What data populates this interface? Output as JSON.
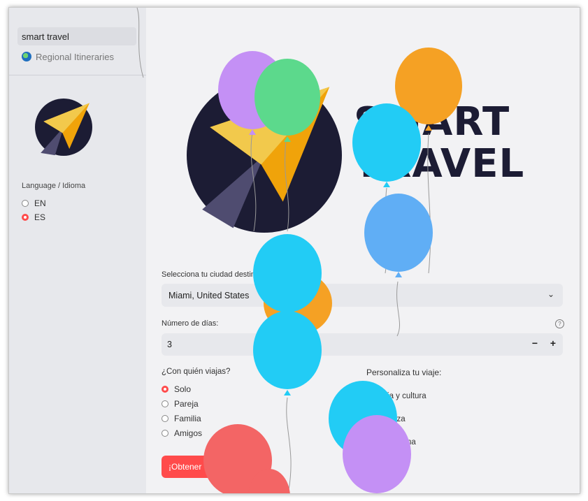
{
  "sidebar": {
    "items": [
      {
        "label": "smart travel",
        "active": true
      },
      {
        "label": "Regional Itineraries",
        "icon": "globe-icon"
      }
    ],
    "language": {
      "label": "Language / Idioma",
      "options": [
        "EN",
        "ES"
      ],
      "selected": "ES"
    }
  },
  "brand": {
    "line1": "SMART",
    "line2": "TRAVEL"
  },
  "form": {
    "city": {
      "label": "Selecciona tu ciudad destino",
      "value": "Miami, United States"
    },
    "days": {
      "label": "Número de días:",
      "value": "3",
      "minus": "−",
      "plus": "+",
      "help_icon": "?"
    },
    "companions": {
      "label": "¿Con quién viajas?",
      "options": [
        "Solo",
        "Pareja",
        "Familia",
        "Amigos"
      ],
      "selected": "Solo"
    },
    "customize": {
      "label": "Personaliza tu viaje:",
      "options": [
        "Historia y cultura",
        "Naturaleza",
        "Vida nocturna"
      ]
    },
    "submit_label": "¡Obtener"
  },
  "colors": {
    "accent": "#ff4b4b",
    "navy": "#1c1c34",
    "plane_yellow": "#f2c94c",
    "plane_orange": "#f0a30a",
    "balloon_purple": "#c490f5",
    "balloon_green": "#5cd98c",
    "balloon_orange": "#f5a124",
    "balloon_cyan": "#22ccf5",
    "balloon_blue": "#60aef5",
    "balloon_red": "#f36565"
  }
}
